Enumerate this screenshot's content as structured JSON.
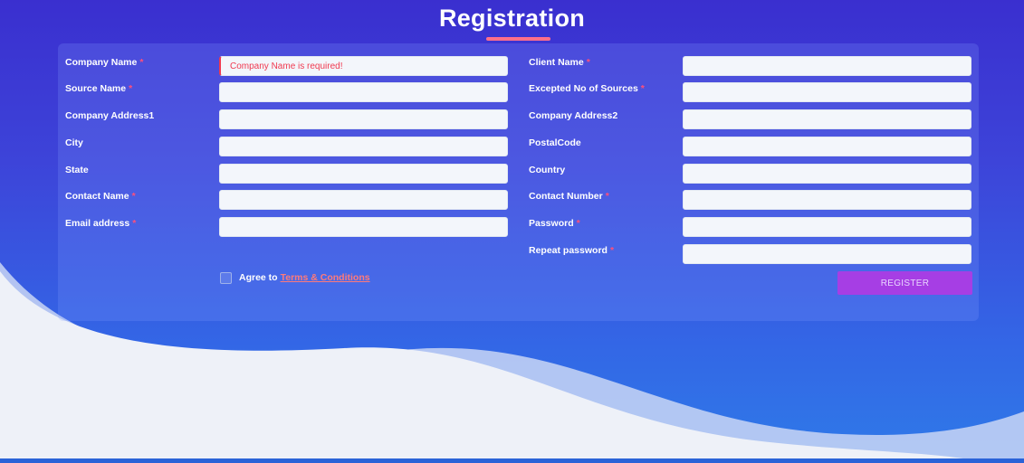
{
  "page": {
    "title": "Registration"
  },
  "colors": {
    "accent_underline": "#ff6f8a",
    "required_marker": "#ff4f7a",
    "error_text": "#f0394f",
    "register_button": "#a63ee4",
    "link": "#ff7a7a"
  },
  "form": {
    "required_marker": "*",
    "left": [
      {
        "label": "Company Name",
        "required": true,
        "value": "",
        "placeholder": "Company Name is required!"
      },
      {
        "label": "Source Name",
        "required": true,
        "value": "",
        "placeholder": ""
      },
      {
        "label": "Company Address1",
        "required": false,
        "value": "",
        "placeholder": ""
      },
      {
        "label": "City",
        "required": false,
        "value": "",
        "placeholder": ""
      },
      {
        "label": "State",
        "required": false,
        "value": "",
        "placeholder": ""
      },
      {
        "label": "Contact Name",
        "required": true,
        "value": "",
        "placeholder": ""
      },
      {
        "label": "Email address",
        "required": true,
        "value": "",
        "placeholder": ""
      }
    ],
    "right": [
      {
        "label": "Client Name",
        "required": true,
        "value": "",
        "placeholder": ""
      },
      {
        "label": "Excepted No of Sources",
        "required": true,
        "value": "",
        "placeholder": ""
      },
      {
        "label": "Company Address2",
        "required": false,
        "value": "",
        "placeholder": ""
      },
      {
        "label": "PostalCode",
        "required": false,
        "value": "",
        "placeholder": ""
      },
      {
        "label": "Country",
        "required": false,
        "value": "",
        "placeholder": ""
      },
      {
        "label": "Contact Number",
        "required": true,
        "value": "",
        "placeholder": ""
      },
      {
        "label": "Password",
        "required": true,
        "value": "",
        "placeholder": ""
      },
      {
        "label": "Repeat password",
        "required": true,
        "value": "",
        "placeholder": ""
      }
    ],
    "agree_text": "Agree to",
    "terms_link": "Terms & Conditions",
    "register_label": "REGISTER"
  }
}
